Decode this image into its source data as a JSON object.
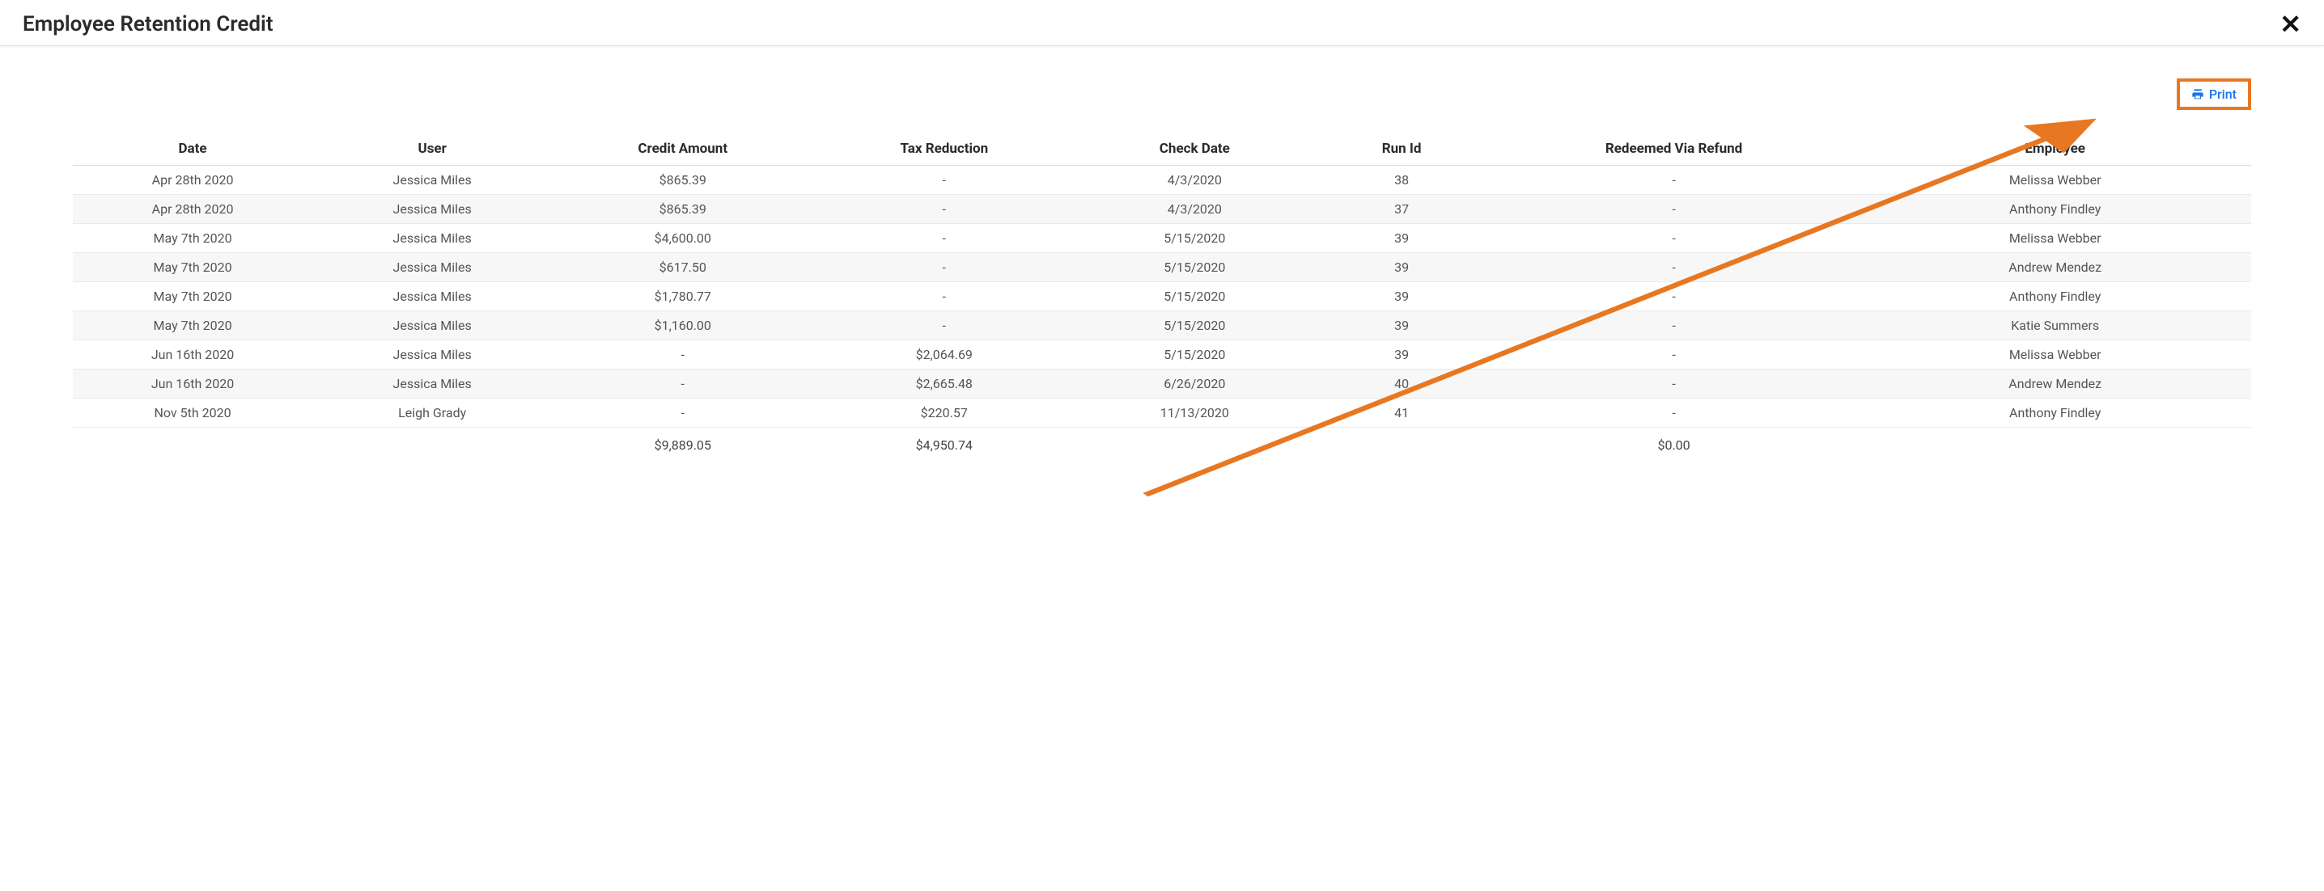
{
  "header": {
    "title": "Employee Retention Credit",
    "close_glyph": "✕"
  },
  "actions": {
    "print_label": "Print"
  },
  "table": {
    "columns": [
      "Date",
      "User",
      "Credit Amount",
      "Tax Reduction",
      "Check Date",
      "Run Id",
      "Redeemed Via Refund",
      "Employee"
    ],
    "rows": [
      {
        "date": "Apr 28th 2020",
        "user": "Jessica Miles",
        "credit": "$865.39",
        "tax": "-",
        "check": "4/3/2020",
        "run": "38",
        "refund": "-",
        "employee": "Melissa Webber"
      },
      {
        "date": "Apr 28th 2020",
        "user": "Jessica Miles",
        "credit": "$865.39",
        "tax": "-",
        "check": "4/3/2020",
        "run": "37",
        "refund": "-",
        "employee": "Anthony Findley"
      },
      {
        "date": "May 7th 2020",
        "user": "Jessica Miles",
        "credit": "$4,600.00",
        "tax": "-",
        "check": "5/15/2020",
        "run": "39",
        "refund": "-",
        "employee": "Melissa Webber"
      },
      {
        "date": "May 7th 2020",
        "user": "Jessica Miles",
        "credit": "$617.50",
        "tax": "-",
        "check": "5/15/2020",
        "run": "39",
        "refund": "-",
        "employee": "Andrew Mendez"
      },
      {
        "date": "May 7th 2020",
        "user": "Jessica Miles",
        "credit": "$1,780.77",
        "tax": "-",
        "check": "5/15/2020",
        "run": "39",
        "refund": "-",
        "employee": "Anthony Findley"
      },
      {
        "date": "May 7th 2020",
        "user": "Jessica Miles",
        "credit": "$1,160.00",
        "tax": "-",
        "check": "5/15/2020",
        "run": "39",
        "refund": "-",
        "employee": "Katie Summers"
      },
      {
        "date": "Jun 16th 2020",
        "user": "Jessica Miles",
        "credit": "-",
        "tax": "$2,064.69",
        "check": "5/15/2020",
        "run": "39",
        "refund": "-",
        "employee": "Melissa Webber"
      },
      {
        "date": "Jun 16th 2020",
        "user": "Jessica Miles",
        "credit": "-",
        "tax": "$2,665.48",
        "check": "6/26/2020",
        "run": "40",
        "refund": "-",
        "employee": "Andrew Mendez"
      },
      {
        "date": "Nov 5th 2020",
        "user": "Leigh Grady",
        "credit": "-",
        "tax": "$220.57",
        "check": "11/13/2020",
        "run": "41",
        "refund": "-",
        "employee": "Anthony Findley"
      }
    ],
    "totals": {
      "credit": "$9,889.05",
      "tax": "$4,950.74",
      "refund": "$0.00"
    }
  },
  "annotation": {
    "color": "#e87722"
  }
}
